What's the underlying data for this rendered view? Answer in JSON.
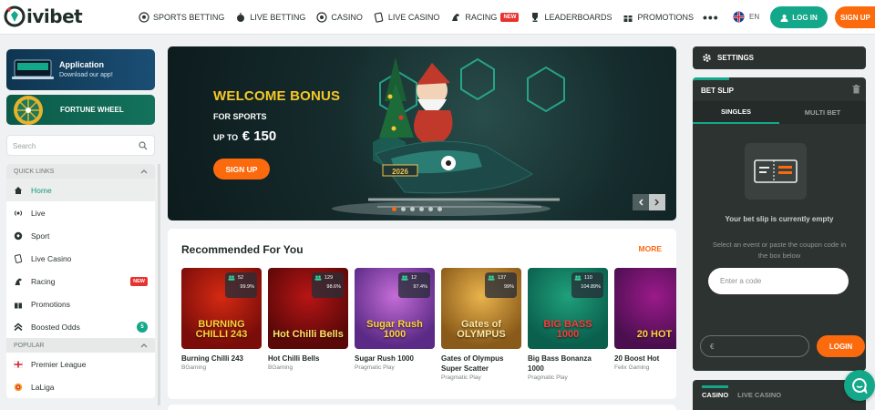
{
  "header": {
    "logo_text": "ivibet",
    "nav": [
      {
        "label": "SPORTS BETTING",
        "icon": "soccer-ball-icon"
      },
      {
        "label": "LIVE BETTING",
        "icon": "live-ball-icon"
      },
      {
        "label": "CASINO",
        "icon": "roulette-icon"
      },
      {
        "label": "LIVE CASINO",
        "icon": "card-icon"
      },
      {
        "label": "RACING",
        "icon": "horse-icon",
        "badge": "NEW"
      },
      {
        "label": "LEADERBOARDS",
        "icon": "trophy-icon"
      },
      {
        "label": "PROMOTIONS",
        "icon": "gift-icon"
      }
    ],
    "more_label": "•••",
    "language": "EN",
    "login_label": "LOG IN",
    "signup_label": "SIGN UP"
  },
  "sidebar": {
    "app_card": {
      "title": "Application",
      "subtitle": "Download our app!"
    },
    "fortune_card": {
      "title": "FORTUNE WHEEL"
    },
    "search": {
      "placeholder": "Search",
      "value": ""
    },
    "quick_links_label": "QUICK LINKS",
    "quick_links": [
      {
        "label": "Home",
        "icon": "home-icon",
        "active": true
      },
      {
        "label": "Live",
        "icon": "live-icon"
      },
      {
        "label": "Sport",
        "icon": "soccer-icon"
      },
      {
        "label": "Live Casino",
        "icon": "card-icon"
      },
      {
        "label": "Racing",
        "icon": "horse-icon",
        "badge": "NEW"
      },
      {
        "label": "Promotions",
        "icon": "gift-icon"
      },
      {
        "label": "Boosted Odds",
        "icon": "boost-icon",
        "count": "5"
      }
    ],
    "popular_label": "POPULAR",
    "popular": [
      {
        "label": "Premier League",
        "icon": "england-flag-icon"
      },
      {
        "label": "LaLiga",
        "icon": "laliga-icon"
      }
    ]
  },
  "banner": {
    "headline": "WELCOME BONUS",
    "line2": "FOR SPORTS",
    "upto": "UP TO",
    "amount": "€ 150",
    "cta": "SIGN UP",
    "plate": "2026",
    "slides": 6,
    "active_slide": 0
  },
  "recommended": {
    "title": "Recommended For You",
    "more_label": "MORE",
    "games": [
      {
        "name": "Burning Chilli 243",
        "provider": "BGaming",
        "players": "52",
        "rtp": "99.9%",
        "art_title": "BURNING CHILLI 243",
        "bg": "#7a0d0a",
        "bg2": "#d52a12",
        "title_color": "#ffd23a"
      },
      {
        "name": "Hot Chilli Bells",
        "provider": "BGaming",
        "players": "129",
        "rtp": "98.6%",
        "art_title": "Hot Chilli Bells",
        "bg": "#5a0808",
        "bg2": "#b81515",
        "title_color": "#ffe066"
      },
      {
        "name": "Sugar Rush 1000",
        "provider": "Pragmatic Play",
        "players": "12",
        "rtp": "97.4%",
        "art_title": "Sugar Rush 1000",
        "bg": "#5b2a86",
        "bg2": "#c46dd6",
        "title_color": "#ffd23a"
      },
      {
        "name": "Gates of Olympus Super Scatter",
        "provider": "Pragmatic Play",
        "players": "137",
        "rtp": "99%",
        "art_title": "Gates of OLYMPUS",
        "bg": "#8a5a1a",
        "bg2": "#e9b44c",
        "title_color": "#ffe9a3"
      },
      {
        "name": "Big Bass Bonanza 1000",
        "provider": "Pragmatic Play",
        "players": "110",
        "rtp": "104.89%",
        "art_title": "BIG BASS 1000",
        "bg": "#0a5f4d",
        "bg2": "#1fa07a",
        "title_color": "#ff3b3b"
      },
      {
        "name": "20 Boost Hot",
        "provider": "Felix Gaming",
        "players": "",
        "rtp": "",
        "art_title": "20 HOT",
        "bg": "#4b0f4f",
        "bg2": "#9b1a8b",
        "title_color": "#ffd23a"
      }
    ]
  },
  "right": {
    "settings_label": "SETTINGS",
    "betslip_title": "BET SLIP",
    "tabs": [
      "SINGLES",
      "MULTI BET"
    ],
    "empty_title": "Your bet slip is currently empty",
    "empty_hint": "Select an event or paste the coupon code in the box below",
    "code_placeholder": "Enter a code",
    "amount_placeholder": "€",
    "login_label": "LOGIN",
    "casino_tabs": [
      "CASINO",
      "LIVE CASINO"
    ]
  },
  "colors": {
    "accent": "#13a88a",
    "orange": "#fc6a0e",
    "dark": "#2d3331"
  }
}
